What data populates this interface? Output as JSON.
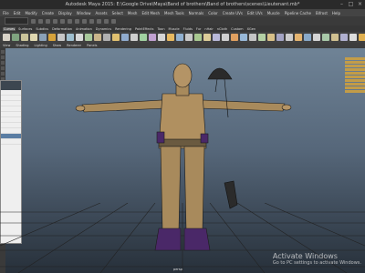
{
  "window": {
    "title": "Autodesk Maya 2015: E:\\Google Drive\\Maya\\Band of brothers\\Band of brothers\\scenes\\Lieutenant.mb*",
    "controls": [
      "–",
      "□",
      "×"
    ]
  },
  "menubar": {
    "items": [
      "File",
      "Edit",
      "Modify",
      "Create",
      "Display",
      "Window",
      "Assets",
      "Select",
      "Mesh",
      "Edit Mesh",
      "Mesh Tools",
      "Normals",
      "Color",
      "Create UVs",
      "Edit UVs",
      "Muscle",
      "Pipeline Cache",
      "Bifrost",
      "Help"
    ]
  },
  "shelf_tabs": {
    "items": [
      "Curves",
      "Surfaces",
      "Subdivs",
      "Deformation",
      "Animation",
      "Dynamics",
      "Rendering",
      "PaintEffects",
      "Toon",
      "Muscle",
      "Fluids",
      "Fur",
      "nHair",
      "nCloth",
      "Custom",
      "XGen"
    ],
    "active_index": 0
  },
  "shelf_icons": {
    "colors": [
      "#d9d3c7",
      "#7fa37f",
      "#c9c39a",
      "#e0d8b0",
      "#8aa0b6",
      "#d6a23a",
      "#c7c7c7",
      "#9fbfcf",
      "#d7d7d7",
      "#a7c79a",
      "#c9b48a",
      "#b0b0b0",
      "#e0c070",
      "#8faacd",
      "#cfcfcf",
      "#a0d0a0",
      "#c0a0d0",
      "#d4d4d4",
      "#e6b860",
      "#90b0d0",
      "#c8c8c8",
      "#a8c890",
      "#dccc98",
      "#b8b8d8",
      "#d0d0d0",
      "#e0a060",
      "#98b8d8",
      "#c4c4c4",
      "#b4d0a4",
      "#d8c088",
      "#a4a4c4",
      "#cccccc",
      "#e4b470",
      "#88a8c8",
      "#d4d4d4",
      "#a8c8a8",
      "#d0c090",
      "#b0b0d0",
      "#dcdcdc",
      "#e0b050",
      "#9ab8d0",
      "#c0c0c0",
      "#b8d8a8",
      "#d8c888",
      "#a8a8c8",
      "#d0d0d0",
      "#e8c070",
      "#7fa0c0"
    ]
  },
  "panel_menu": {
    "items": [
      "View",
      "Shading",
      "Lighting",
      "Show",
      "Renderer",
      "Panels"
    ]
  },
  "viewport": {
    "camera_label": "persp",
    "accent_color": "#5a2a7a"
  },
  "watermark": {
    "line1": "Activate Windows",
    "line2": "Go to PC settings to activate Windows."
  }
}
